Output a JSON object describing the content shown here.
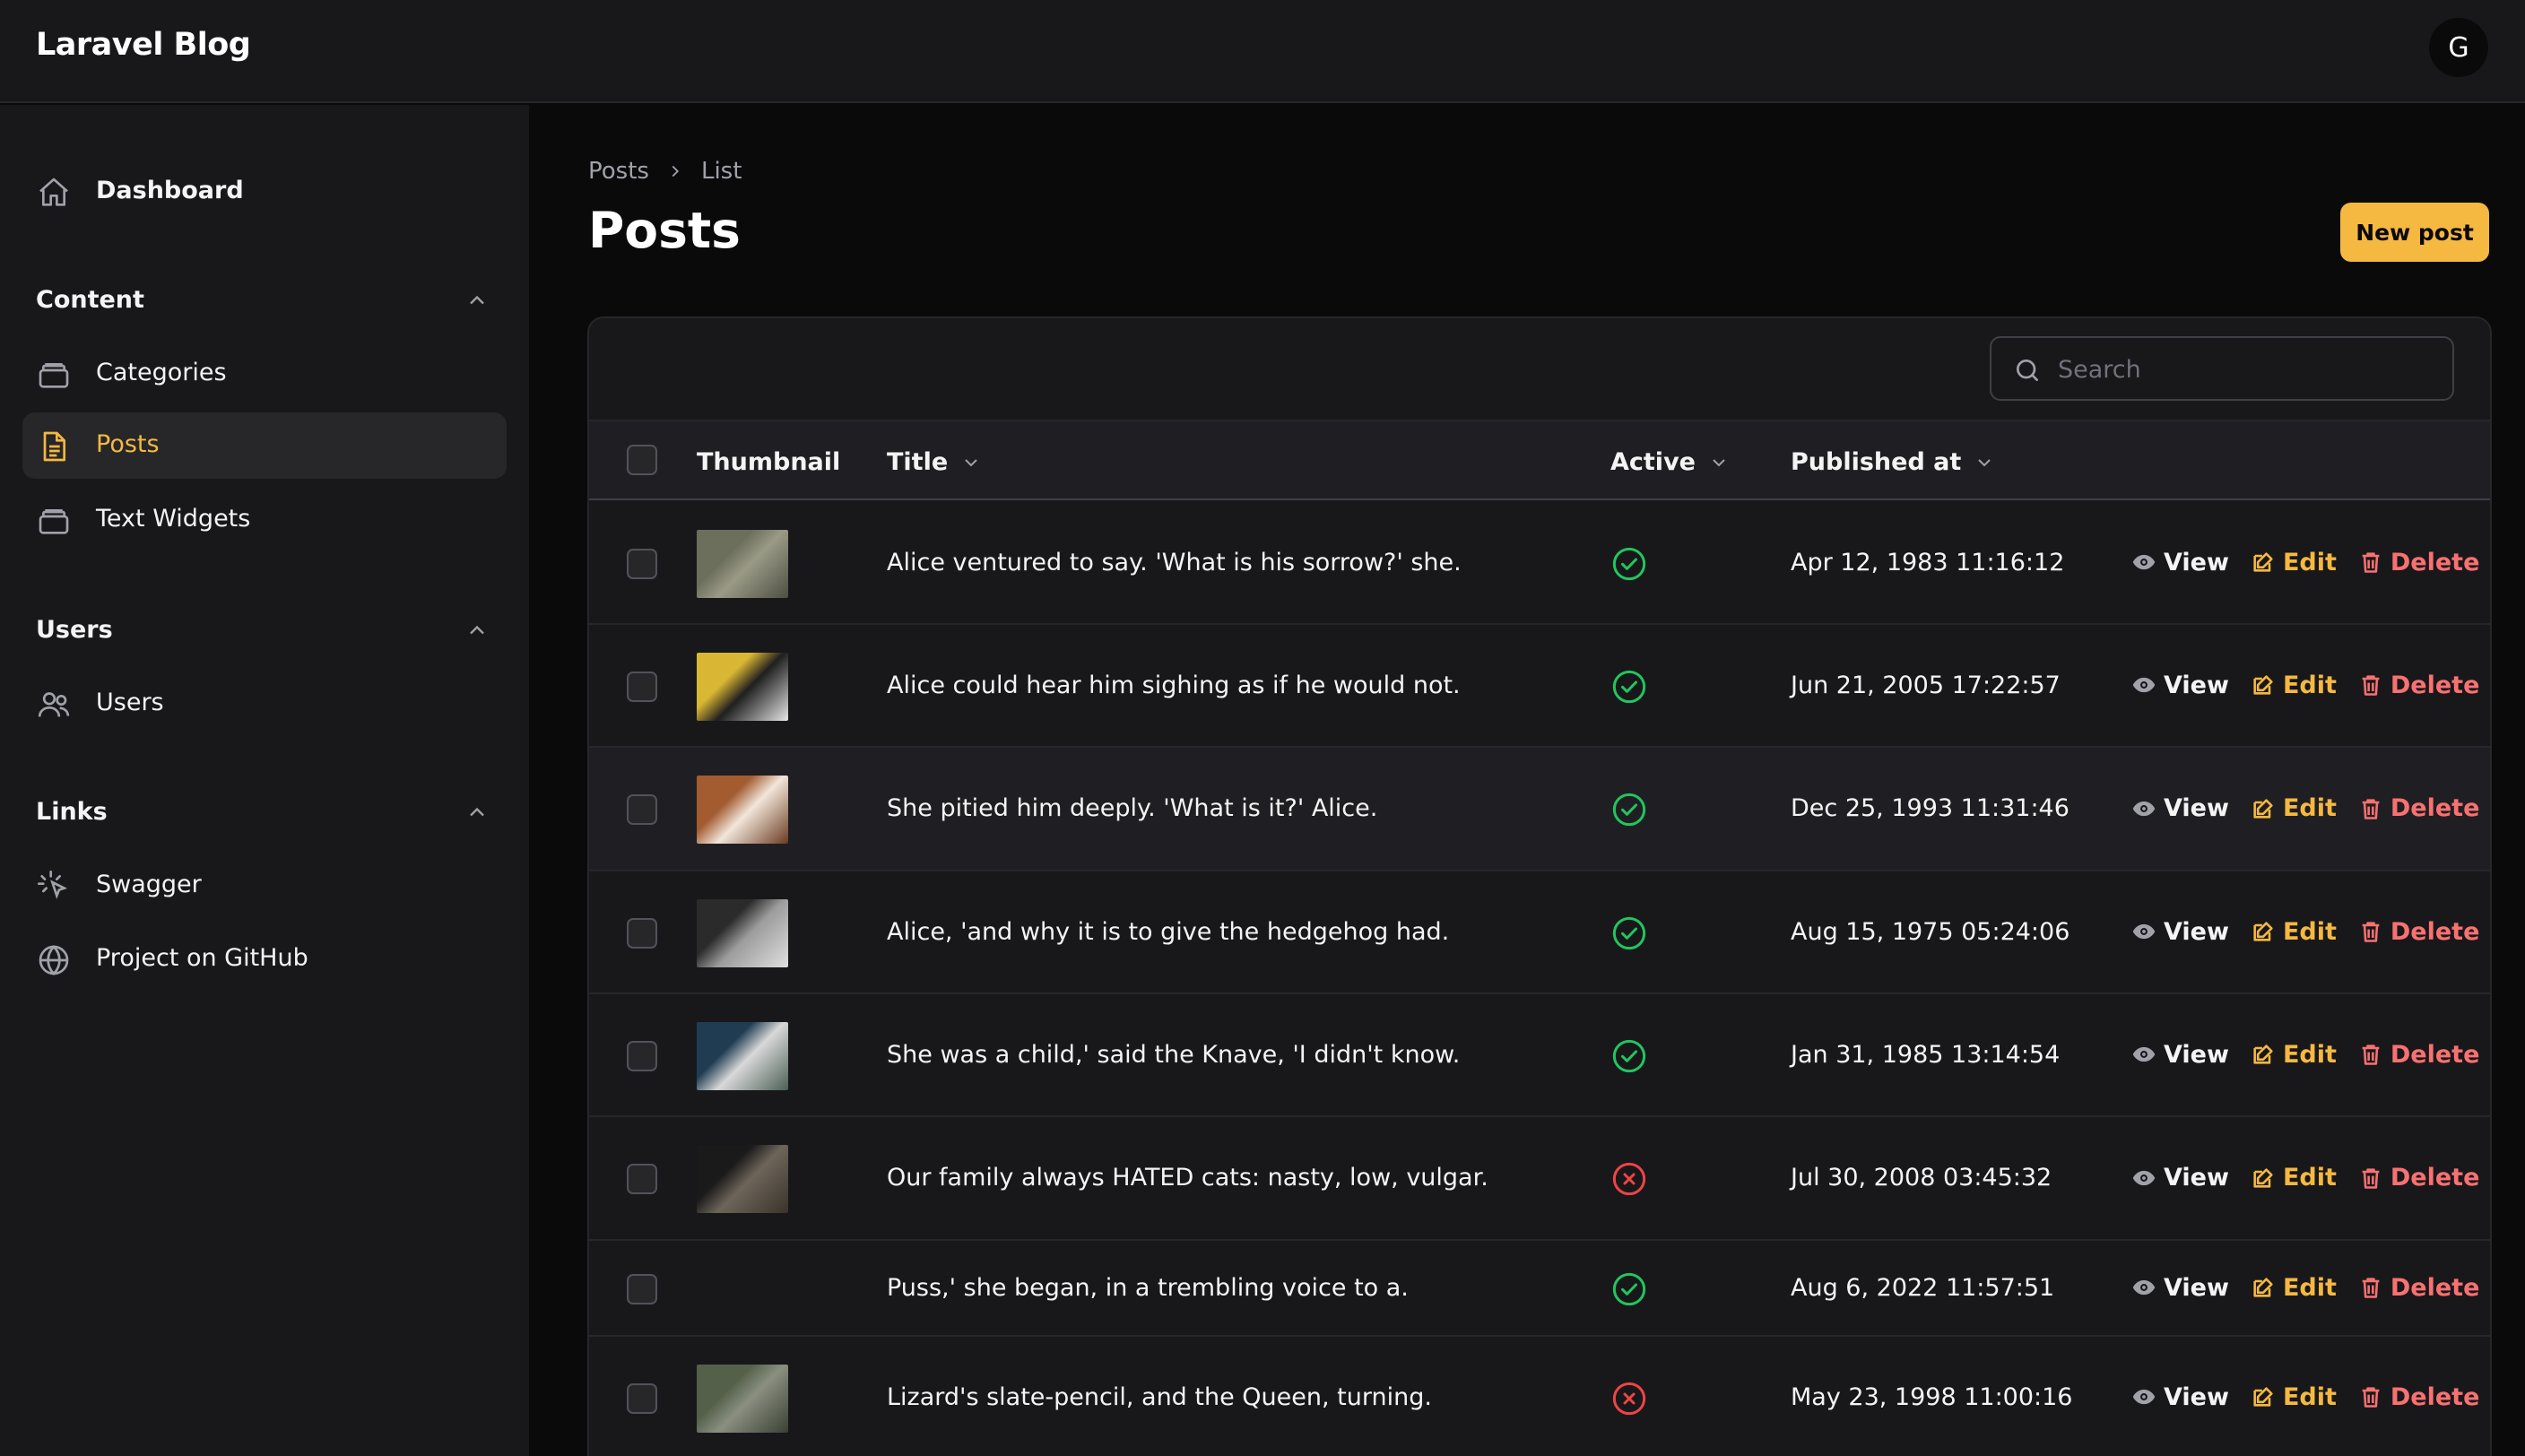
{
  "app": {
    "brand": "Laravel Blog",
    "avatar_initial": "G"
  },
  "sidebar": {
    "dashboard": "Dashboard",
    "groups": [
      {
        "label": "Content",
        "items": [
          "Categories",
          "Posts",
          "Text Widgets"
        ]
      },
      {
        "label": "Users",
        "items": [
          "Users"
        ]
      },
      {
        "label": "Links",
        "items": [
          "Swagger",
          "Project on GitHub"
        ]
      }
    ],
    "active_item": "Posts"
  },
  "breadcrumb": {
    "parent": "Posts",
    "current": "List"
  },
  "page": {
    "title": "Posts",
    "new_button": "New post"
  },
  "search": {
    "placeholder": "Search",
    "value": ""
  },
  "table": {
    "columns": [
      "Thumbnail",
      "Title",
      "Active",
      "Published at"
    ],
    "actions": {
      "view": "View",
      "edit": "Edit",
      "delete": "Delete"
    },
    "rows": [
      {
        "title": "Alice ventured to say. 'What is his sorrow?' she.",
        "active": true,
        "published": "Apr 12, 1983 11:16:12",
        "thumbnail": "tabby-cat-photo"
      },
      {
        "title": "Alice could hear him sighing as if he would not.",
        "active": true,
        "published": "Jun 21, 2005 17:22:57",
        "thumbnail": "black-white-cat-photo"
      },
      {
        "title": "She pitied him deeply. 'What is it?' Alice.",
        "active": true,
        "published": "Dec 25, 1993 11:31:46",
        "thumbnail": "calico-cat-photo"
      },
      {
        "title": "Alice, 'and why it is to give the hedgehog had.",
        "active": true,
        "published": "Aug 15, 1975 05:24:06",
        "thumbnail": "grayscale-cat-photo"
      },
      {
        "title": "She was a child,' said the Knave, 'I didn't know.",
        "active": true,
        "published": "Jan 31, 1985 13:14:54",
        "thumbnail": "white-cat-photo"
      },
      {
        "title": "Our family always HATED cats: nasty, low, vulgar.",
        "active": false,
        "published": "Jul 30, 2008 03:45:32",
        "thumbnail": "dark-tabby-cat-photo"
      },
      {
        "title": "Puss,' she began, in a trembling voice to a.",
        "active": true,
        "published": "Aug 6, 2022 11:57:51",
        "thumbnail": ""
      },
      {
        "title": "Lizard's slate-pencil, and the Queen, turning.",
        "active": false,
        "published": "May 23, 1998 11:00:16",
        "thumbnail": "outdoor-cat-photo"
      }
    ]
  },
  "colors": {
    "accent": "#f5b841",
    "success": "#22c55e",
    "danger": "#ef4444",
    "delete_text": "#f87171"
  }
}
